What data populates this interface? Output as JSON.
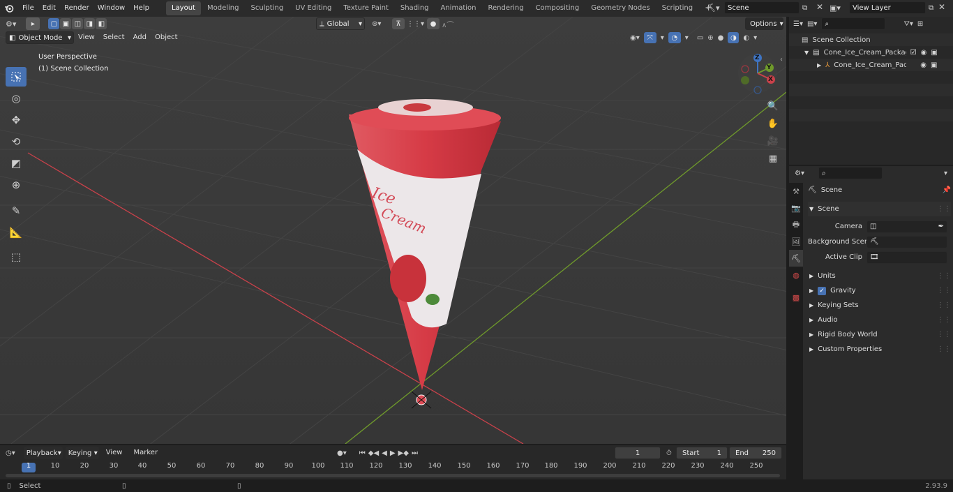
{
  "app": {
    "logo": "blender-logo-icon"
  },
  "menus": [
    "File",
    "Edit",
    "Render",
    "Window",
    "Help"
  ],
  "workspaces": [
    "Layout",
    "Modeling",
    "Sculpting",
    "UV Editing",
    "Texture Paint",
    "Shading",
    "Animation",
    "Rendering",
    "Compositing",
    "Geometry Nodes",
    "Scripting"
  ],
  "active_workspace": "Layout",
  "scene_selector": "Scene",
  "view_layer": "View Layer",
  "viewport": {
    "mode": "Object Mode",
    "menus": [
      "View",
      "Select",
      "Add",
      "Object"
    ],
    "transform_orientation": "Global",
    "options_label": "Options",
    "overlay_title": "User Perspective",
    "overlay_subtitle": "(1) Scene Collection",
    "gizmo_axes": {
      "z": "Z",
      "y": "Y",
      "x": "X"
    },
    "object_labels": {
      "line1": "Ice",
      "line2": "Cream"
    },
    "colors": {
      "x_axis": "#c9414a",
      "y_axis": "#6f9a2b",
      "z_axis": "#3f74c2",
      "cone": "#d9414b"
    }
  },
  "outliner": {
    "root": "Scene Collection",
    "items": [
      {
        "label": "Cone_Ice_Cream_Package_M"
      },
      {
        "label": "Cone_Ice_Cream_Packag"
      }
    ]
  },
  "properties": {
    "breadcrumb": "Scene",
    "panel_title": "Scene",
    "fields": [
      {
        "label": "Camera"
      },
      {
        "label": "Background Scene"
      },
      {
        "label": "Active Clip"
      }
    ],
    "subpanels": [
      "Units",
      "Gravity",
      "Keying Sets",
      "Audio",
      "Rigid Body World",
      "Custom Properties"
    ]
  },
  "timeline": {
    "menus": [
      "Playback",
      "Keying",
      "View",
      "Marker"
    ],
    "current_frame": "1",
    "start_label": "Start",
    "start": "1",
    "end_label": "End",
    "end": "250",
    "ticks": [
      "1",
      "10",
      "20",
      "30",
      "40",
      "50",
      "60",
      "70",
      "80",
      "90",
      "100",
      "110",
      "120",
      "130",
      "140",
      "150",
      "160",
      "170",
      "180",
      "190",
      "200",
      "210",
      "220",
      "230",
      "240",
      "250"
    ]
  },
  "status": {
    "left": "Select",
    "version": "2.93.9"
  }
}
